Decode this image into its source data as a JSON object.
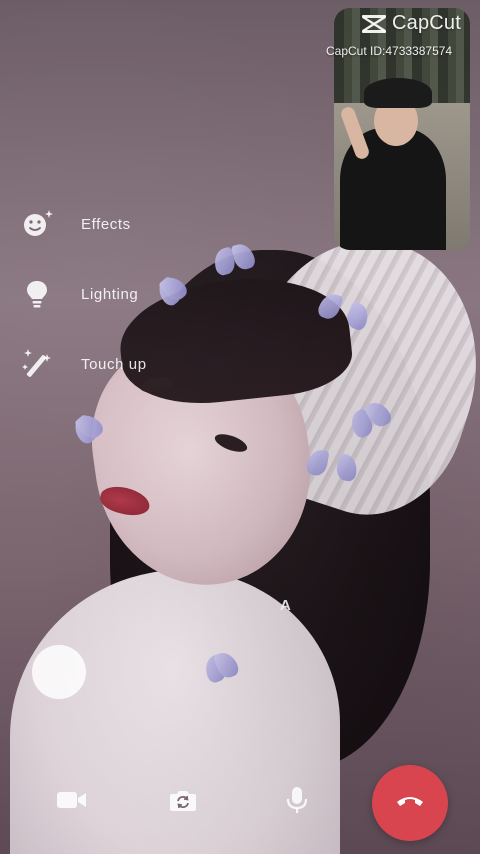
{
  "pip": {
    "brand": "CapCut",
    "id_text": "CapCut ID:4733387574"
  },
  "menu": [
    {
      "icon": "smiley-sparkle-icon",
      "label": "Effects"
    },
    {
      "icon": "lightbulb-icon",
      "label": "Lighting"
    },
    {
      "icon": "magic-wand-icon",
      "label": "Touch up"
    }
  ],
  "overlay_text": "A",
  "controls": {
    "camera_icon": "video-camera-icon",
    "flip_icon": "camera-flip-icon",
    "mic_icon": "microphone-icon",
    "end_icon": "end-call-icon"
  },
  "colors": {
    "end_call": "#d8454e",
    "icon_white": "#ffffff"
  }
}
